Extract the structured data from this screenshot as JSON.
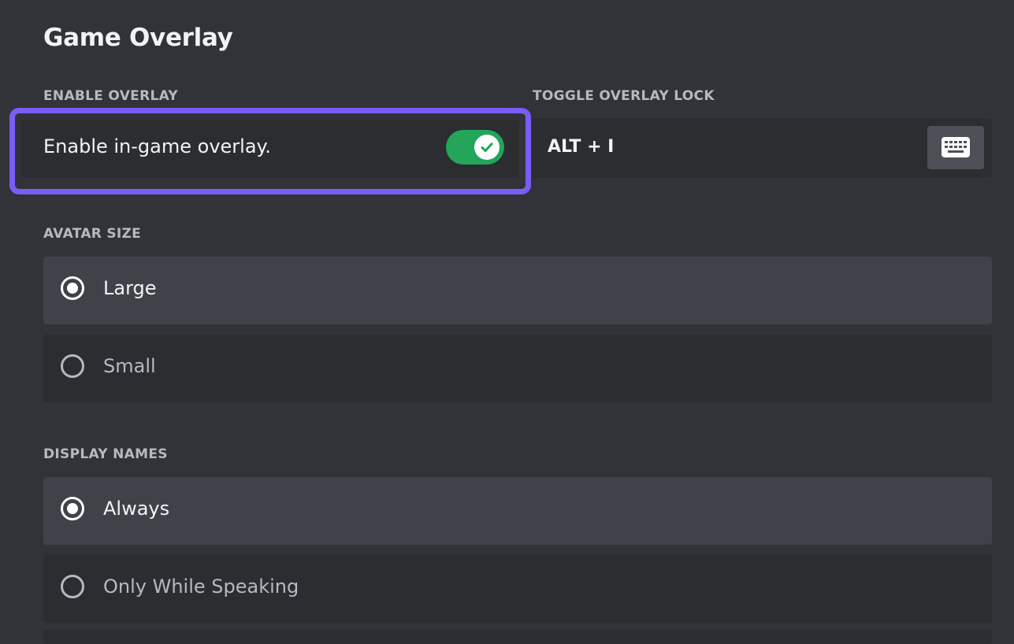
{
  "page": {
    "title": "Game Overlay"
  },
  "enable_overlay": {
    "section_label": "ENABLE OVERLAY",
    "text": "Enable in-game overlay.",
    "enabled": true,
    "highlight_color": "#7a5cf7",
    "toggle_color": "#23a55a"
  },
  "toggle_lock": {
    "section_label": "TOGGLE OVERLAY LOCK",
    "keybind": "ALT + I",
    "button_icon": "keyboard-icon"
  },
  "avatar_size": {
    "section_label": "AVATAR SIZE",
    "options": [
      {
        "label": "Large",
        "selected": true
      },
      {
        "label": "Small",
        "selected": false
      }
    ]
  },
  "display_names": {
    "section_label": "DISPLAY NAMES",
    "options": [
      {
        "label": "Always",
        "selected": true
      },
      {
        "label": "Only While Speaking",
        "selected": false
      }
    ]
  }
}
